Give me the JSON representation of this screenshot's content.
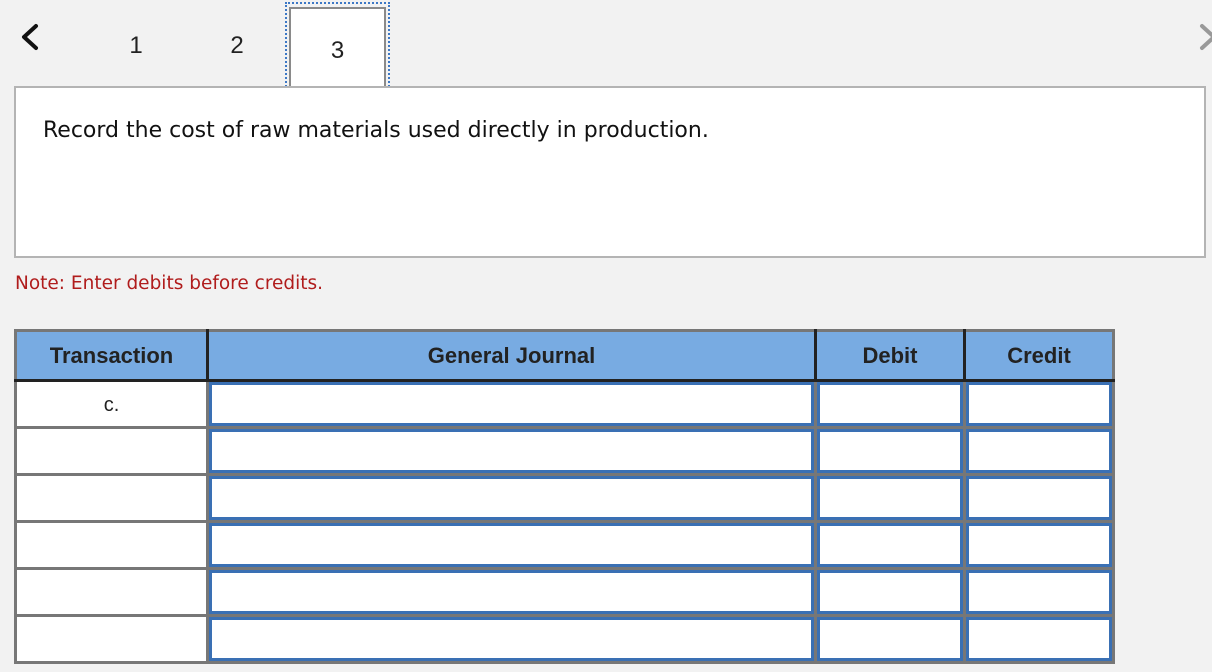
{
  "nav": {
    "prev_icon": "chevron-left-icon",
    "next_icon": "chevron-right-icon",
    "tabs": [
      {
        "label": "1",
        "active": false
      },
      {
        "label": "2",
        "active": false
      },
      {
        "label": "3",
        "active": true
      }
    ]
  },
  "question": {
    "text": "Record the cost of raw materials used directly in production."
  },
  "note": "Note: Enter debits before credits.",
  "journal": {
    "headers": [
      "Transaction",
      "General Journal",
      "Debit",
      "Credit"
    ],
    "rows": [
      {
        "transaction": "c.",
        "account": "",
        "debit": "",
        "credit": ""
      },
      {
        "transaction": "",
        "account": "",
        "debit": "",
        "credit": ""
      },
      {
        "transaction": "",
        "account": "",
        "debit": "",
        "credit": ""
      },
      {
        "transaction": "",
        "account": "",
        "debit": "",
        "credit": ""
      },
      {
        "transaction": "",
        "account": "",
        "debit": "",
        "credit": ""
      },
      {
        "transaction": "",
        "account": "",
        "debit": "",
        "credit": ""
      }
    ]
  },
  "colors": {
    "header_bg": "#78abe2",
    "input_border": "#3a70b4",
    "note_text": "#b01c1c",
    "focus_outline": "#3d78c5"
  }
}
